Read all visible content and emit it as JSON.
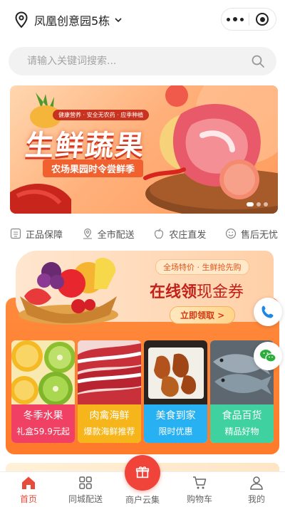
{
  "header": {
    "location": "凤凰创意园5栋",
    "icons": {
      "location": "location-pin-icon",
      "dropdown": "chevron-down-icon",
      "more": "more-dots-icon",
      "close": "record-circle-icon"
    }
  },
  "search": {
    "placeholder": "请输入关键词搜索..."
  },
  "banner": {
    "badge": "健康营养 · 安全无农药 · 应季种植",
    "title": "生鲜蔬果",
    "subtitle": "农场果园时令尝鲜季"
  },
  "features": [
    {
      "label": "正品保障",
      "icon": "certificate-icon"
    },
    {
      "label": "全市配送",
      "icon": "location-person-icon"
    },
    {
      "label": "农庄直发",
      "icon": "apple-icon"
    },
    {
      "label": "售后无忧",
      "icon": "smile-icon"
    }
  ],
  "coupon": {
    "tag": "全场特价 · 生鲜抢先购",
    "title_strong": "在线领",
    "title_light": "现金券",
    "button": "立即领取 >"
  },
  "categories": [
    {
      "name": "冬季水果",
      "sub": "礼盒59.9元起",
      "color": "#f04063"
    },
    {
      "name": "肉禽海鲜",
      "sub": "爆款海鲜推荐",
      "color": "#f6b51a"
    },
    {
      "name": "美食到家",
      "sub": "限时优惠",
      "color": "#27b0f2"
    },
    {
      "name": "食品百货",
      "sub": "精品好物",
      "color": "#3fd2a0"
    }
  ],
  "floating": {
    "phone": "phone-icon",
    "wechat": "wechat-icon"
  },
  "tabbar": [
    {
      "label": "首页",
      "icon": "home-icon",
      "active": true
    },
    {
      "label": "同城配送",
      "icon": "grid-icon",
      "active": false
    },
    {
      "label": "商户云集",
      "icon": "gift-icon",
      "active": false
    },
    {
      "label": "购物车",
      "icon": "cart-icon",
      "active": false
    },
    {
      "label": "我的",
      "icon": "user-icon",
      "active": false
    }
  ],
  "colors": {
    "accent": "#f0433a",
    "promo_orange": "#ff7a2a",
    "coupon_red": "#c2201a"
  }
}
